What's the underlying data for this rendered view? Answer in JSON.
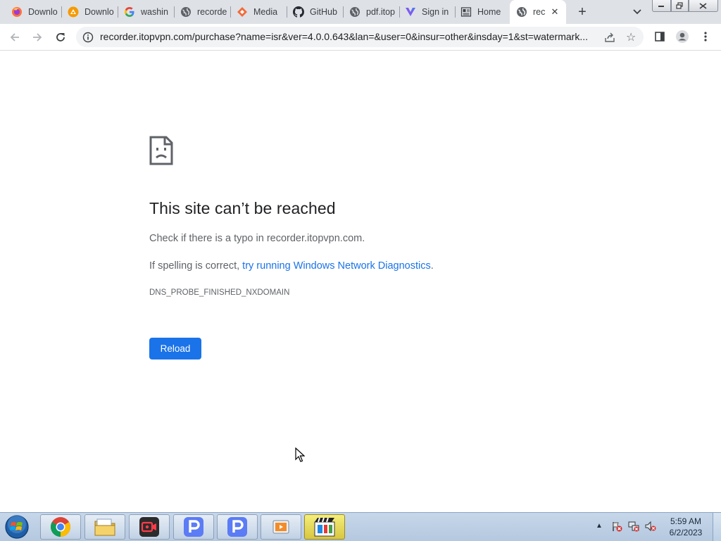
{
  "browser": {
    "tabs": [
      {
        "title": "Downlo",
        "icon": "firefox-icon"
      },
      {
        "title": "Downlo",
        "icon": "download-app-icon"
      },
      {
        "title": "washin",
        "icon": "google-icon"
      },
      {
        "title": "recorde",
        "icon": "globe-icon"
      },
      {
        "title": "Media",
        "icon": "media-app-icon"
      },
      {
        "title": "GitHub",
        "icon": "github-icon"
      },
      {
        "title": "pdf.itop",
        "icon": "globe-icon"
      },
      {
        "title": "Sign in",
        "icon": "sign-in-app-icon"
      },
      {
        "title": "Home",
        "icon": "home-page-icon"
      },
      {
        "title": "rec",
        "icon": "globe-icon",
        "active": true
      }
    ],
    "url": "recorder.itopvpn.com/purchase?name=isr&ver=4.0.0.643&lan=&user=0&insur=other&insday=1&st=watermark..."
  },
  "error_page": {
    "title": "This site can’t be reached",
    "line1": "Check if there is a typo in recorder.itopvpn.com.",
    "line2_prefix": "If spelling is correct, ",
    "line2_link": "try running Windows Network Diagnostics",
    "line2_suffix": ".",
    "error_code": "DNS_PROBE_FINISHED_NXDOMAIN",
    "reload_label": "Reload"
  },
  "taskbar": {
    "apps": [
      "chrome-icon",
      "file-explorer-icon",
      "screen-recorder-icon",
      "p-app-icon",
      "p-app-icon",
      "video-player-icon",
      "media-editor-icon"
    ],
    "clock_time": "5:59 AM",
    "clock_date": "6/2/2023"
  },
  "colors": {
    "accent": "#1a73e8",
    "tabstrip": "#dee1e6",
    "text_primary": "#202124",
    "text_secondary": "#5f6368"
  }
}
